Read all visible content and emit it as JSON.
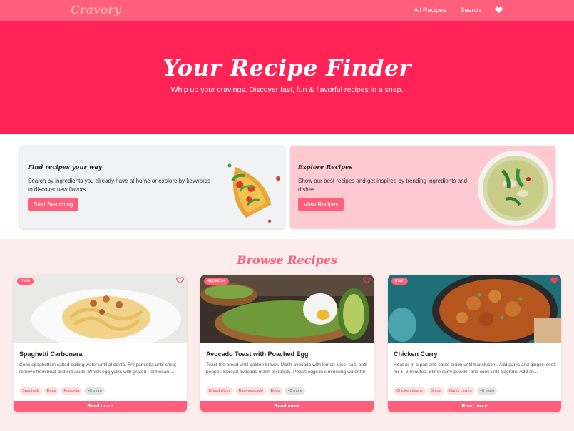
{
  "nav": {
    "logo": "Cravory",
    "links": [
      "All Recipes",
      "Search"
    ],
    "favorites_icon": "heart-icon"
  },
  "hero": {
    "title": "Your Recipe Finder",
    "subtitle": "Whip up your cravings. Discover fast, fun & flavorful recipes in a snap."
  },
  "features": [
    {
      "title": "Find recipes your way",
      "description": "Search by ingredients you already have at home or explore by keywords to discover new flavors.",
      "button": "Start Searching"
    },
    {
      "title": "Explore Recipes",
      "description": "Show our best recipes and get inspired by trending ingredients and dishes.",
      "button": "View Recipes"
    }
  ],
  "browse": {
    "title": "Browse Recipes",
    "read_more": "Read more",
    "recipes": [
      {
        "badge": "main",
        "title": "Spaghetti Carbonara",
        "description": "Cook spaghetti in salted boiling water until al dente. Fry pancetta until crisp; remove from heat and set aside. Whisk egg yolks with grated Parmesan ...",
        "tags": [
          "Spaghetti",
          "Eggs",
          "Pancetta"
        ],
        "more": "+3 more",
        "favorited": false
      },
      {
        "badge": "appetizer",
        "title": "Avocado Toast with Poached Egg",
        "description": "Toast the bread until golden brown. Mash avocado with lemon juice, salt, and pepper. Spread avocado mash on toasts. Poach eggs in simmering water for ...",
        "tags": [
          "Bread slices",
          "Ripe avocado",
          "Eggs"
        ],
        "more": "+2 more",
        "favorited": false
      },
      {
        "badge": "main",
        "title": "Chicken Curry",
        "description": "Heat oil in a pan and sauté onion until translucent. Add garlic and ginger; cook for 1–2 minutes. Stir in curry powder and cook until fragrant. Add ch...",
        "tags": [
          "Chicken thighs",
          "Onion",
          "Garlic cloves"
        ],
        "more": "+6 more",
        "favorited": true
      }
    ]
  },
  "colors": {
    "primary": "#ff5f7a",
    "hero": "#ff2356",
    "logo": "#ffb3a8"
  }
}
